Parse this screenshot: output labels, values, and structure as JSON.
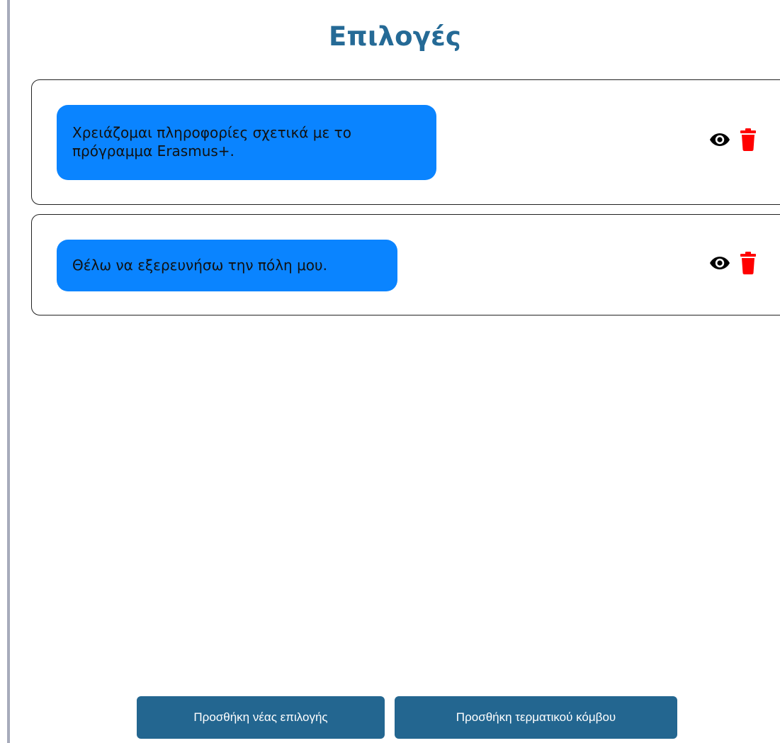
{
  "header": {
    "title": "Επιλογές"
  },
  "options": [
    {
      "text": "Χρειάζομαι πληροφορίες σχετικά με το πρόγραμμα Erasmus+.",
      "view_icon": "eye-icon",
      "delete_icon": "trash-icon"
    },
    {
      "text": "Θέλω να εξερευνήσω την πόλη μου.",
      "view_icon": "eye-icon",
      "delete_icon": "trash-icon"
    }
  ],
  "footer": {
    "add_option_label": "Προσθήκη νέας επιλογής",
    "add_terminal_label": "Προσθήκη τερματικού κόμβου"
  },
  "colors": {
    "title": "#256a96",
    "bubble": "#0a84ff",
    "button": "#236690",
    "delete": "#ff0000",
    "view": "#000000"
  }
}
